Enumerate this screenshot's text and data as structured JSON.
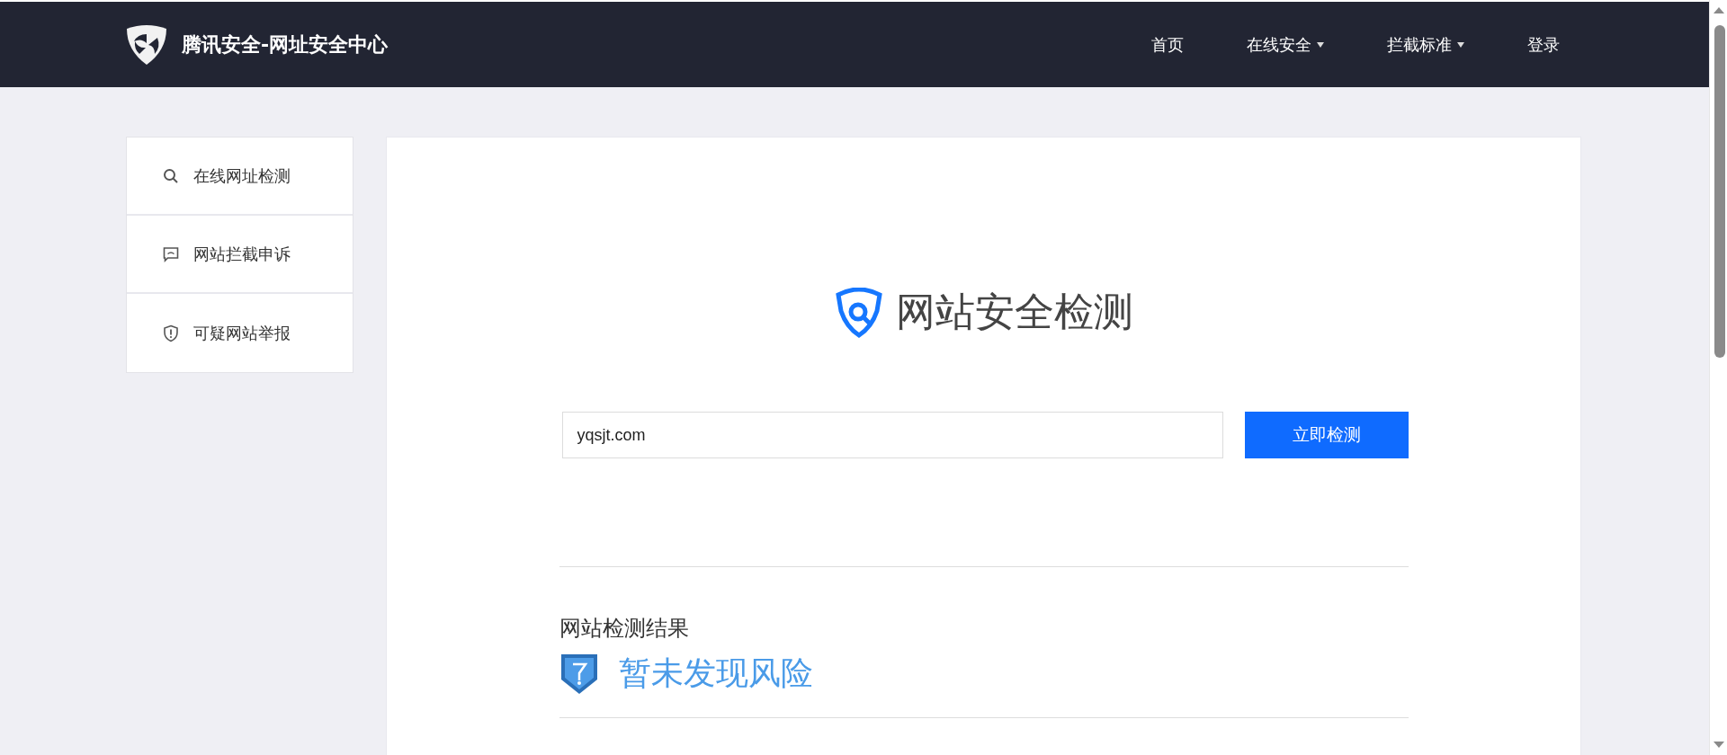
{
  "header": {
    "title": "腾讯安全-网址安全中心",
    "nav": [
      {
        "label": "首页",
        "dropdown": false
      },
      {
        "label": "在线安全",
        "dropdown": true
      },
      {
        "label": "拦截标准",
        "dropdown": true
      },
      {
        "label": "登录",
        "dropdown": false
      }
    ]
  },
  "sidebar": {
    "items": [
      {
        "label": "在线网址检测",
        "kind": "search"
      },
      {
        "label": "网站拦截申诉",
        "kind": "comment"
      },
      {
        "label": "可疑网站举报",
        "kind": "shield"
      }
    ]
  },
  "main": {
    "heading": "网站安全检测",
    "url_field": {
      "value": "yqsjt.com"
    },
    "check_button": "立即检测",
    "result": {
      "label": "网站检测结果",
      "status": "暂未发现风险"
    }
  }
}
